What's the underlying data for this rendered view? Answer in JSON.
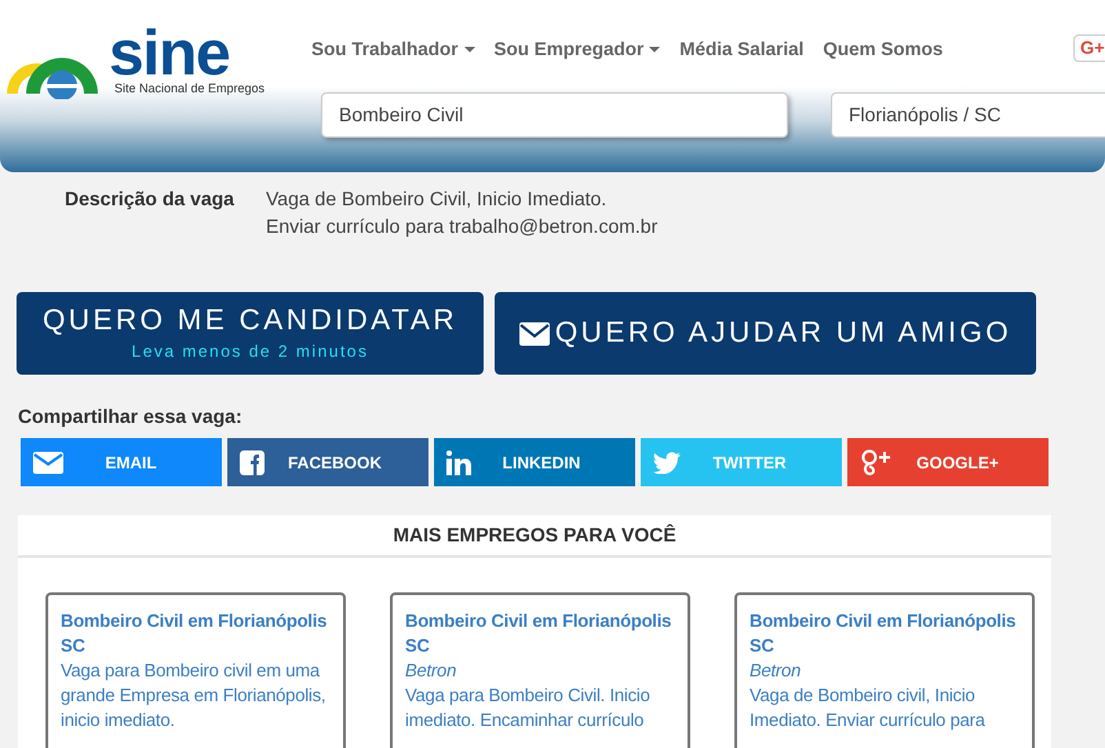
{
  "logo": {
    "name": "sine",
    "tagline": "Site Nacional de Empregos"
  },
  "nav": [
    {
      "label": "Sou Trabalhador",
      "dropdown": true
    },
    {
      "label": "Sou Empregador",
      "dropdown": true
    },
    {
      "label": "Média Salarial",
      "dropdown": false
    },
    {
      "label": "Quem Somos",
      "dropdown": false
    }
  ],
  "gplus_badge": "G+",
  "search": {
    "job": "Bombeiro Civil",
    "location": "Florianópolis / SC"
  },
  "description": {
    "label": "Descrição da vaga",
    "lines": [
      "Vaga de Bombeiro Civil, Inicio Imediato.",
      "Enviar currículo para trabalho@betron.com.br"
    ]
  },
  "apply_button": {
    "label": "QUERO ME CANDIDATAR",
    "sublabel": "Leva menos de 2 minutos"
  },
  "friend_button": {
    "label": "QUERO AJUDAR UM AMIGO"
  },
  "share": {
    "label": "Compartilhar essa vaga:",
    "buttons": [
      {
        "kind": "email",
        "label": "EMAIL"
      },
      {
        "kind": "facebook",
        "label": "FACEBOOK"
      },
      {
        "kind": "linkedin",
        "label": "LINKEDIN"
      },
      {
        "kind": "twitter",
        "label": "TWITTER"
      },
      {
        "kind": "google",
        "label": "GOOGLE+"
      }
    ]
  },
  "more_jobs": {
    "title": "MAIS EMPREGOS PARA VOCÊ",
    "cards": [
      {
        "title": "Bombeiro Civil em Florianópolis SC",
        "text": "Vaga para Bombeiro civil em uma grande Empresa em Florianópolis, inicio imediato."
      },
      {
        "title": "Bombeiro Civil em Florianópolis SC",
        "company": "Betron",
        "text": "Vaga para Bombeiro Civil. Inicio imediato. Encaminhar currículo"
      },
      {
        "title": "Bombeiro Civil em Florianópolis SC",
        "company": "Betron",
        "text": "Vaga de Bombeiro civil, Inicio Imediato. Enviar currículo para"
      }
    ]
  }
}
